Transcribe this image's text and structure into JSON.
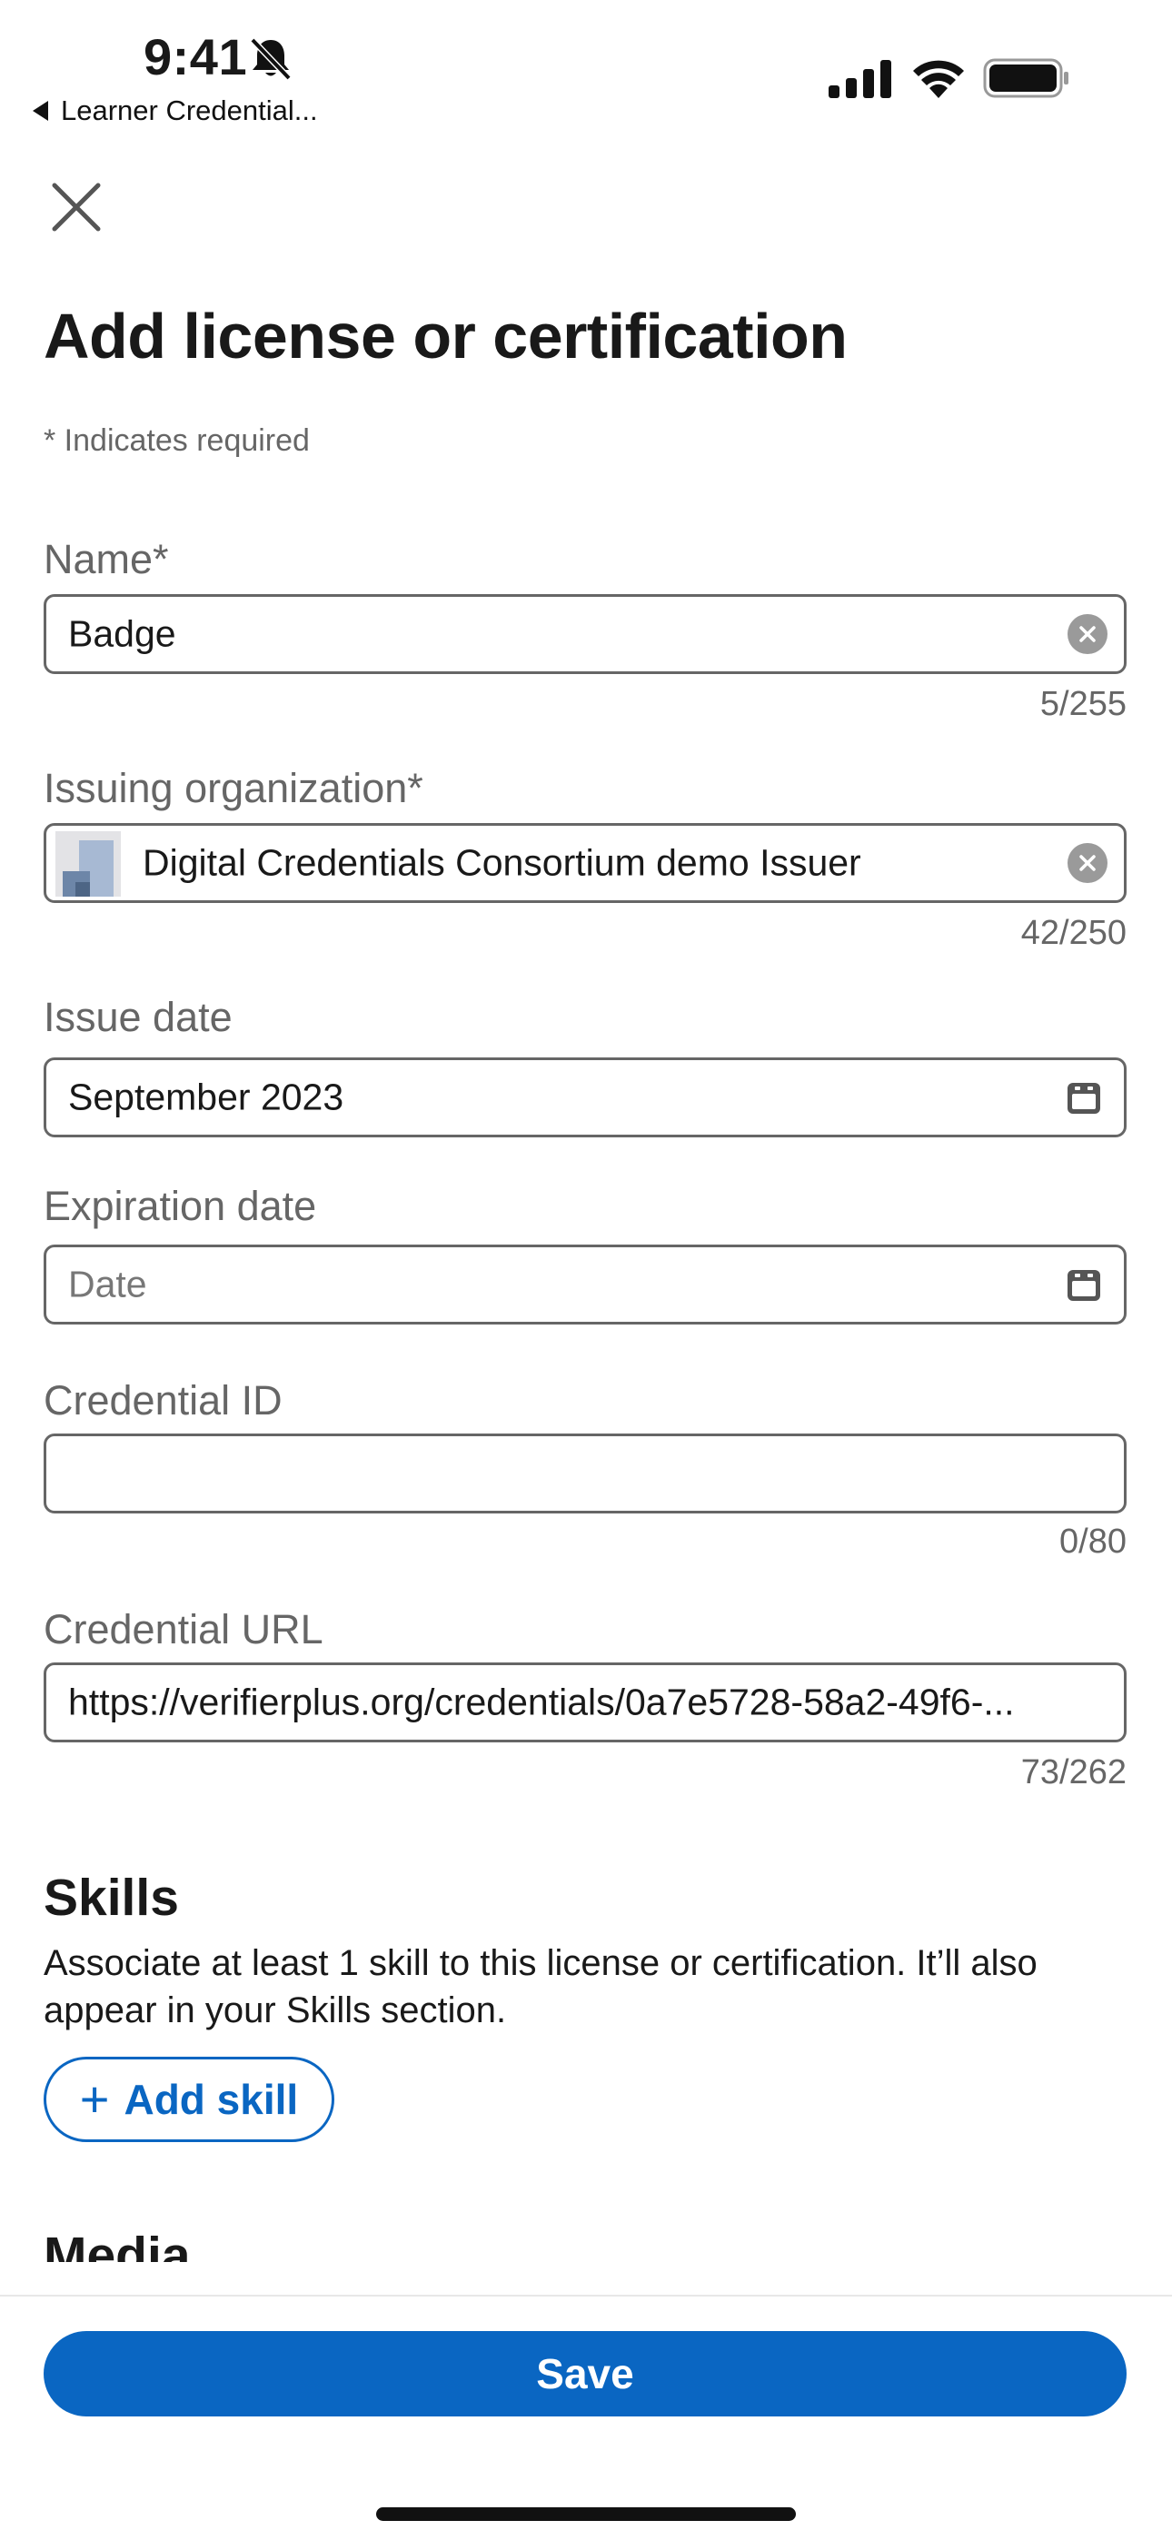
{
  "status_bar": {
    "time": "9:41",
    "back_app": "Learner Credential...",
    "icons": [
      "bell-slash-icon",
      "signal-icon",
      "wifi-icon",
      "battery-icon"
    ]
  },
  "header": {
    "close_icon": "close-icon",
    "title": "Add license or certification",
    "required_note": "* Indicates required"
  },
  "form": {
    "name": {
      "label": "Name*",
      "value": "Badge",
      "count": "5/255"
    },
    "issuing_org": {
      "label": "Issuing organization*",
      "value": "Digital Credentials Consortium demo Issuer",
      "count": "42/250"
    },
    "issue_date": {
      "label": "Issue date",
      "value": "September 2023"
    },
    "expiration_date": {
      "label": "Expiration date",
      "placeholder": "Date"
    },
    "credential_id": {
      "label": "Credential ID",
      "value": "",
      "count": "0/80"
    },
    "credential_url": {
      "label": "Credential URL",
      "value": "https://verifierplus.org/credentials/0a7e5728-58a2-49f6-...",
      "count": "73/262"
    }
  },
  "skills": {
    "title": "Skills",
    "description": "Associate at least 1 skill to this license or certification. It’ll also appear in your Skills section.",
    "add_button": "Add skill"
  },
  "media": {
    "title": "Media"
  },
  "footer": {
    "save_label": "Save"
  },
  "colors": {
    "accent": "#0a66c2",
    "border": "#666666",
    "muted_text": "#666666"
  }
}
